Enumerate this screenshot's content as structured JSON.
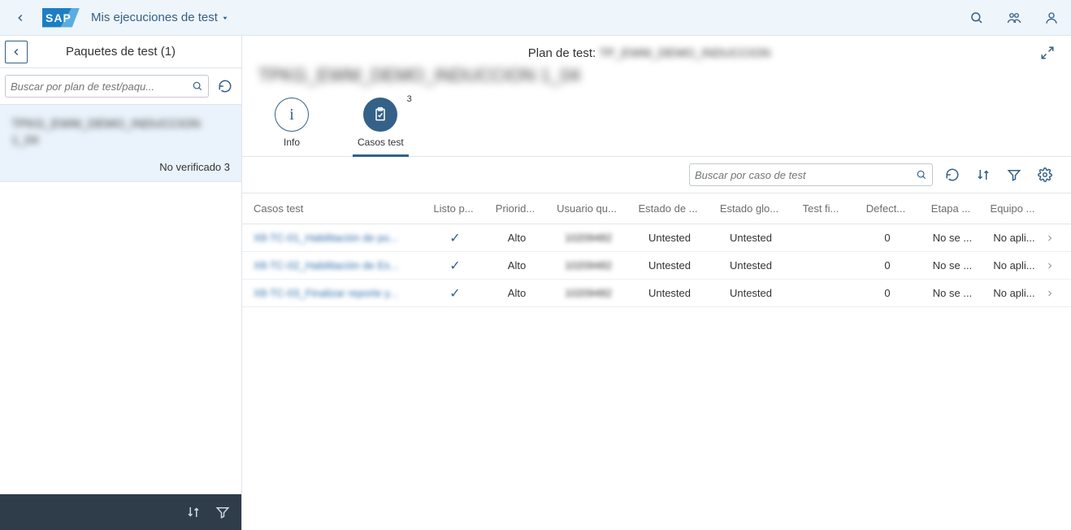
{
  "shell": {
    "app_title": "Mis ejecuciones de test"
  },
  "master": {
    "title": "Paquetes de test (1)",
    "search_placeholder": "Buscar por plan de test/paqu...",
    "item": {
      "title": "TPKG_EWM_DEMO_INDUCCION 1_04",
      "status": "No verificado 3"
    }
  },
  "detail": {
    "plan_prefix": "Plan de test:",
    "plan_value": "TP_EWM_DEMO_INDUCCION",
    "title": "TPKG_EWM_DEMO_INDUCCION 1_04",
    "tabs": {
      "info": "Info",
      "cases": "Casos test",
      "cases_count": "3"
    },
    "toolbar": {
      "search_placeholder": "Buscar por caso de test"
    },
    "columns": {
      "c1": "Casos test",
      "c2": "Listo p...",
      "c3": "Priorid...",
      "c4": "Usuario qu...",
      "c5": "Estado de ...",
      "c6": "Estado glo...",
      "c7": "Test fi...",
      "c8": "Defect...",
      "c9": "Etapa ...",
      "c10": "Equipo ..."
    },
    "rows": [
      {
        "case": "X8-TC-01_Habilitación de po...",
        "priority": "Alto",
        "user": "10209482",
        "state": "Untested",
        "global": "Untested",
        "fi": "",
        "defects": "0",
        "etapa": "No se ...",
        "equipo": "No apli..."
      },
      {
        "case": "X8-TC-02_Habilitación de Es...",
        "priority": "Alto",
        "user": "10209482",
        "state": "Untested",
        "global": "Untested",
        "fi": "",
        "defects": "0",
        "etapa": "No se ...",
        "equipo": "No apli..."
      },
      {
        "case": "X8-TC-03_Finalizar reporte y...",
        "priority": "Alto",
        "user": "10209482",
        "state": "Untested",
        "global": "Untested",
        "fi": "",
        "defects": "0",
        "etapa": "No se ...",
        "equipo": "No apli..."
      }
    ]
  }
}
